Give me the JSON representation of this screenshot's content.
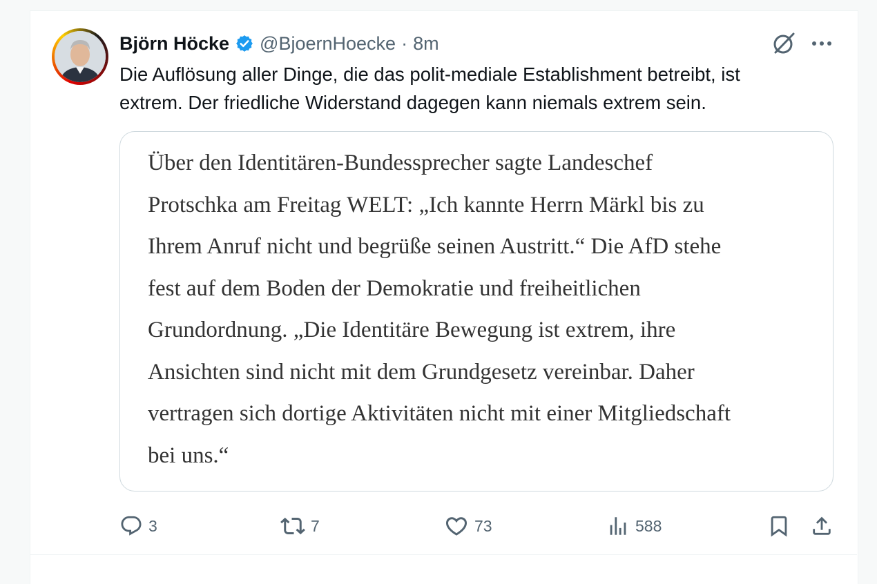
{
  "author": {
    "name": "Björn Höcke",
    "handle": "@BjoernHoecke",
    "separator": "·",
    "time": "8m",
    "verified_badge_color": "#1d9bf0"
  },
  "tweet": {
    "text": "Die Auflösung aller Dinge, die das polit-mediale Establishment betreibt, ist\nextrem. Der friedliche Widerstand dagegen kann niemals extrem sein."
  },
  "quoted_image": {
    "text": "Über den Identitären-Bundessprecher sagte Landeschef\nProtschka am Freitag WELT: „Ich kannte Herrn Märkl bis zu\nIhrem Anruf nicht und begrüße seinen Austritt.“ Die AfD stehe\nfest auf dem Boden der Demokratie und freiheitlichen\nGrundordnung. „Die Identitäre Bewegung ist extrem, ihre\nAnsichten sind nicht mit dem Grundgesetz vereinbar. Daher\nvertragen sich dortige Aktivitäten nicht mit einer Mitgliedschaft\nbei uns.“"
  },
  "actions": {
    "replies": "3",
    "reposts": "7",
    "likes": "73",
    "views": "588"
  },
  "icons": [
    "verified-badge-icon",
    "grok-icon",
    "more-icon",
    "reply-icon",
    "repost-icon",
    "like-icon",
    "views-icon",
    "bookmark-icon",
    "share-icon"
  ],
  "colors": {
    "text": "#0f1419",
    "secondary": "#536471",
    "border": "#cfd9de",
    "accent": "#1d9bf0"
  }
}
